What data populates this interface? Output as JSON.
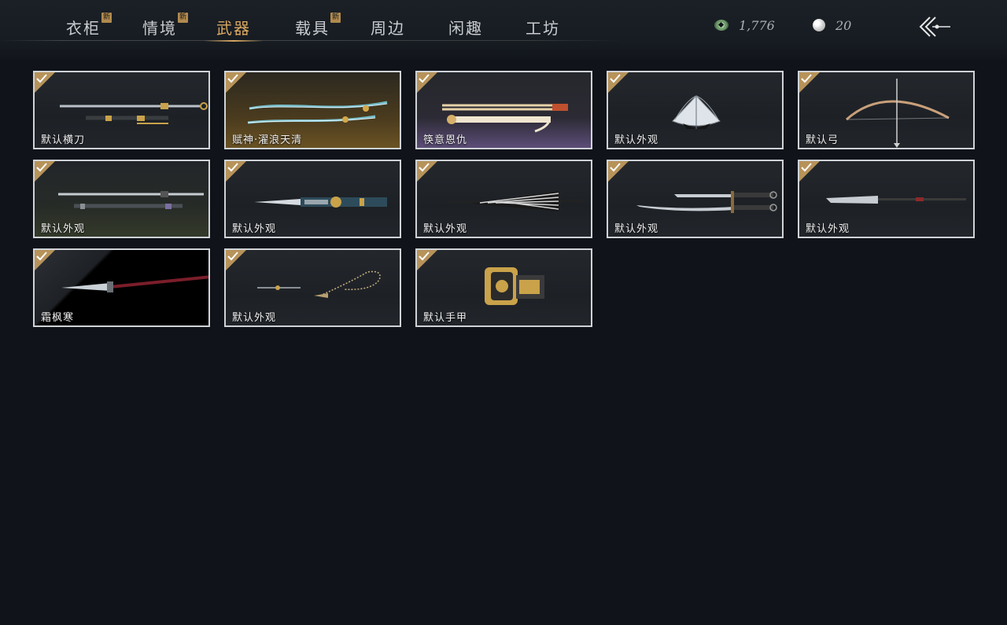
{
  "tabs": [
    {
      "label": "衣柜",
      "badge": "新"
    },
    {
      "label": "情境",
      "badge": "新"
    },
    {
      "label": "武器",
      "badge": ""
    },
    {
      "label": "载具",
      "badge": "新"
    },
    {
      "label": "周边",
      "badge": ""
    },
    {
      "label": "闲趣",
      "badge": ""
    },
    {
      "label": "工坊",
      "badge": ""
    }
  ],
  "active_tab": "武器",
  "currency": {
    "jade_coin": "1,776",
    "pearl": "20"
  },
  "items": [
    {
      "label": "默认横刀",
      "icon": "dual-blades-icon"
    },
    {
      "label": "赋神·濯浪天清",
      "icon": "glowing-blades-icon"
    },
    {
      "label": "筷意恩仇",
      "icon": "chopsticks-icon"
    },
    {
      "label": "默认外观",
      "icon": "folding-fan-icon"
    },
    {
      "label": "默认弓",
      "icon": "bow-icon"
    },
    {
      "label": "默认外观",
      "icon": "long-sword-icon"
    },
    {
      "label": "默认外观",
      "icon": "ornate-sword-icon"
    },
    {
      "label": "默认外观",
      "icon": "umbrella-icon"
    },
    {
      "label": "默认外观",
      "icon": "twin-sabres-icon"
    },
    {
      "label": "默认外观",
      "icon": "glaive-icon"
    },
    {
      "label": "霜枫寒",
      "icon": "spear-icon"
    },
    {
      "label": "默认外观",
      "icon": "rope-dart-icon"
    },
    {
      "label": "默认手甲",
      "icon": "gauntlet-icon"
    }
  ],
  "colors": {
    "accent": "#d9a860",
    "background": "#10141a",
    "card_border": "#cfd3d7",
    "check_badge": "#b7935a"
  }
}
